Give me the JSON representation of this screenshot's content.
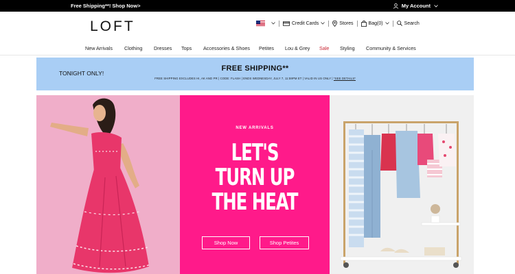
{
  "topbar": {
    "promo": "Free Shipping**! Shop Now>",
    "account_label": "My Account"
  },
  "header": {
    "logo": "LOFT",
    "utilities": {
      "credit_cards": "Credit Cards",
      "stores": "Stores",
      "bag": "Bag(0)",
      "search": "Search"
    }
  },
  "nav": {
    "items": [
      "New Arrivals",
      "Clothing",
      "Dresses",
      "Tops",
      "Accessories & Shoes",
      "Petites",
      "Lou & Grey",
      "Sale",
      "Styling",
      "Community & Services"
    ]
  },
  "banner": {
    "tonight": "TONIGHT ONLY!",
    "title": "FREE SHIPPING**",
    "details": "FREE SHIPPING EXCLUDES HI, AK AND PR | CODE: FLASH | ENDS WEDNESDAY, JULY 7, 11:59PM ET | VALID IN US ONLY |",
    "details_link": "*SEE DETAILS*"
  },
  "hero": {
    "eyebrow": "NEW ARRIVALS",
    "headline": [
      "LET'S",
      "TURN UP",
      "THE HEAT"
    ],
    "primary_cta": "Shop Now",
    "secondary_cta": "Shop Petites"
  },
  "colors": {
    "hero_pink": "#ff1a8a",
    "banner_blue": "#a9cef5",
    "sale_red": "#c7222f",
    "hero_left_bg": "#f0aec9"
  },
  "icons": [
    "user-icon",
    "chevron-down-icon",
    "flag-icon",
    "credit-card-icon",
    "location-pin-icon",
    "bag-icon",
    "search-icon"
  ]
}
